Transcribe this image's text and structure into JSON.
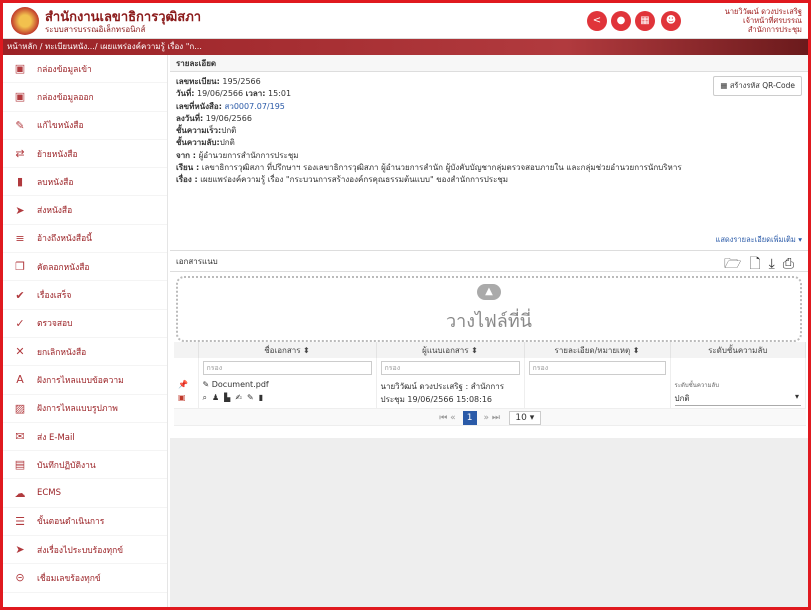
{
  "header": {
    "title": "สำนักงานเลขาธิการวุฒิสภา",
    "subtitle": "ระบบสารบรรณอิเล็กทรอนิกส์",
    "user_name": "นายวิวัฒน์ ดวงประเสริฐ",
    "user_role": "เจ้าหน้าที่ศรบรรณ",
    "user_org": "สำนักการประชุม"
  },
  "breadcrumb": "หน้าหลัก / ทะเบียนหนัง.../ เผยแพร่องค์ความรู้ เรื่อง \"ก...",
  "sidebar": {
    "items": [
      {
        "label": "กล่องข้อมูลเข้า",
        "icon": "inbox-icon"
      },
      {
        "label": "กล่องข้อมูลออก",
        "icon": "outbox-icon"
      },
      {
        "label": "แก้ไขหนังสือ",
        "icon": "edit-icon"
      },
      {
        "label": "ย้ายหนังสือ",
        "icon": "move-icon"
      },
      {
        "label": "ลบหนังสือ",
        "icon": "trash-icon"
      },
      {
        "label": "ส่งหนังสือ",
        "icon": "send-icon"
      },
      {
        "label": "อ้างถึงหนังสือนี้",
        "icon": "reference-icon"
      },
      {
        "label": "คัดลอกหนังสือ",
        "icon": "copy-icon"
      },
      {
        "label": "เรื่องเสร็จ",
        "icon": "done-icon"
      },
      {
        "label": "ตรวจสอบ",
        "icon": "check-icon"
      },
      {
        "label": "ยกเลิกหนังสือ",
        "icon": "cancel-icon"
      },
      {
        "label": "ฝังการไหลแบบข้อความ",
        "icon": "text-icon"
      },
      {
        "label": "ฝังการไหลแบบรูปภาพ",
        "icon": "image-icon"
      },
      {
        "label": "ส่ง E-Mail",
        "icon": "mail-icon"
      },
      {
        "label": "บันทึกปฏิบัติงาน",
        "icon": "log-icon"
      },
      {
        "label": "ECMS",
        "icon": "cloud-icon"
      },
      {
        "label": "ขั้นตอนดำเนินการ",
        "icon": "list-icon"
      },
      {
        "label": "ส่งเรื่องไประบบร้องทุกข์",
        "icon": "forward-icon"
      },
      {
        "label": "เชื่อมเลขร้องทุกข์",
        "icon": "link-icon"
      }
    ]
  },
  "details": {
    "section_title": "รายละเอียด",
    "qr_button": "สร้างรหัส QR-Code",
    "reg_label": "เลขทะเบียน:",
    "reg_value": "195/2566",
    "date_label": "วันที่:",
    "date_value": "19/06/2566",
    "time_label": "เวลา:",
    "time_value": "15:01",
    "doc_no_label": "เลขที่หนังสือ:",
    "doc_no_value": "สว0007.07/195",
    "dated_label": "ลงวันที่:",
    "dated_value": "19/06/2566",
    "speed_label": "ชั้นความเร็ว:",
    "speed_value": "ปกติ",
    "secret_label": "ชั้นความลับ:",
    "secret_value": "ปกติ",
    "from_label": "จาก :",
    "from_value": "ผู้อำนวยการสำนักการประชุม",
    "to_label": "เรียน :",
    "to_value": "เลขาธิการวุฒิสภา ที่ปรึกษาฯ รองเลขาธิการวุฒิสภา ผู้อำนวยการสำนัก ผู้บังคับบัญชากลุ่มตรวจสอบภายใน และกลุ่มช่วยอำนวยการนักบริหาร",
    "subject_label": "เรื่อง :",
    "subject_value": "เผยแพร่องค์ความรู้ เรื่อง \"กระบวนการสร้างองค์กรคุณธรรมต้นแบบ\" ของสำนักการประชุม",
    "more_link": "แสดงรายละเอียดเพิ่มเติม ▾"
  },
  "attachments": {
    "section_title": "เอกสารแนบ",
    "drop_text": "วางไฟล์ที่นี่",
    "columns": [
      "ชื่อเอกสาร ⬍",
      "ผู้แนบเอกสาร ⬍",
      "รายละเอียด/หมายเหตุ ⬍",
      "ระดับชั้นความลับ"
    ],
    "filter_placeholder": "กรอง",
    "row": {
      "file_name": "Document.pdf",
      "uploader": "นายวิวัฒน์ ดวงประเสริฐ : สำนักการประชุม 19/06/2566 15:08:16",
      "secret_label": "ระดับชั้นความลับ",
      "secret_value": "ปกติ"
    },
    "pager": {
      "current": "1",
      "page_size": "10"
    }
  }
}
